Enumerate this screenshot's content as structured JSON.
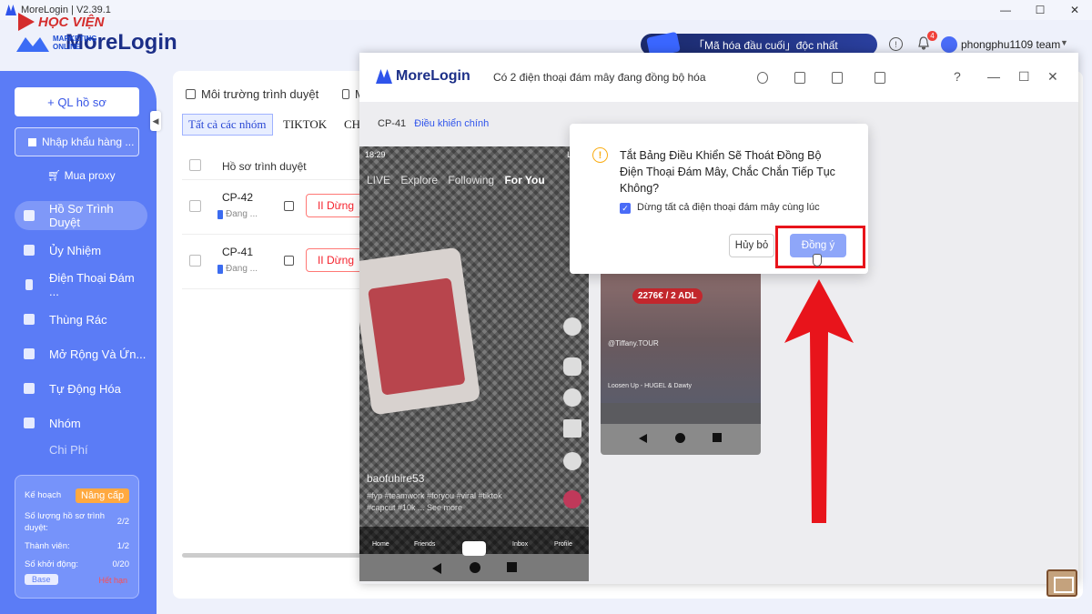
{
  "window": {
    "title": "MoreLogin | V2.39.1",
    "controls": [
      "—",
      "☐",
      "✕"
    ]
  },
  "brand": {
    "name": "MoreLogin"
  },
  "watermark": {
    "text": "HỌC VIỆN",
    "sub": "MARKETING ONLINE"
  },
  "header": {
    "announcement": "「Mã hóa đầu cuối」độc nhất",
    "notifications_count": "4",
    "username": "phongphu1109 team"
  },
  "sidebar": {
    "new_profile": "+ QL hồ sơ",
    "import": "Nhập khẩu hàng ...",
    "buy_proxy": "Mua proxy",
    "items": [
      {
        "label": "Hồ Sơ Trình Duyệt",
        "active": true
      },
      {
        "label": "Ủy Nhiệm"
      },
      {
        "label": "Điện Thoại Đám ..."
      },
      {
        "label": "Thùng Rác"
      },
      {
        "label": "Mở Rộng Và Ứn..."
      },
      {
        "label": "Tự Động Hóa"
      },
      {
        "label": "Nhóm"
      },
      {
        "label": "Chi Phí"
      }
    ],
    "plan": {
      "label": "Kế hoạch",
      "upgrade": "Nâng cấp",
      "profiles_label": "Số lượng hồ sơ trình duyệt:",
      "profiles_value": "2/2",
      "members_label": "Thành viên:",
      "members_value": "1/2",
      "launch_label": "Số khởi động:",
      "launch_value": "0/20",
      "tier": "Base",
      "expired": "Hết hạn"
    }
  },
  "main": {
    "tabs": [
      {
        "label": "Môi trường trình duyệt"
      },
      {
        "label": "M"
      }
    ],
    "filters": [
      "Tất cả các nhóm",
      "TIKTOK",
      "CH"
    ],
    "table_header": "Hồ sơ trình duyệt",
    "rows": [
      {
        "name": "CP-42",
        "status": "Đang ...",
        "action": "II Dừng"
      },
      {
        "name": "CP-41",
        "status": "Đang ...",
        "action": "II Dừng"
      }
    ]
  },
  "sync": {
    "brand": "MoreLogin",
    "title": "Có 2 điện thoại đám mây đang đồng bộ hóa",
    "device": "CP-41",
    "control_link": "Điều khiển chính",
    "phone": {
      "time": "18:29",
      "signal": "LTE",
      "tabs": [
        "LIVE",
        "Explore",
        "Following",
        "For You"
      ],
      "username": "baofuhire53",
      "tags": "#fyp #teamwork #foryou #viral #tiktok #capcut #10k ... See more",
      "nav": [
        "Home",
        "Friends",
        "+",
        "Inbox",
        "Profile"
      ]
    },
    "phone2": {
      "price": "2276€ / 2 ADL",
      "user": "@Tiffany.TOUR",
      "song": "Loosen Up - HUGEL & Dawty"
    }
  },
  "dialog": {
    "message": "Tắt Bảng Điều Khiển Sẽ Thoát Đồng Bộ Điện Thoại Đám Mây, Chắc Chắn Tiếp Tục Không?",
    "checkbox_label": "Dừng tất cả điện thoại đám mây cùng lúc",
    "cancel": "Hủy bỏ",
    "ok": "Đồng ý"
  },
  "colors": {
    "accent": "#5b7cf6",
    "brand": "#1c2f88",
    "danger": "#f5222d",
    "highlight": "#e8141b"
  }
}
